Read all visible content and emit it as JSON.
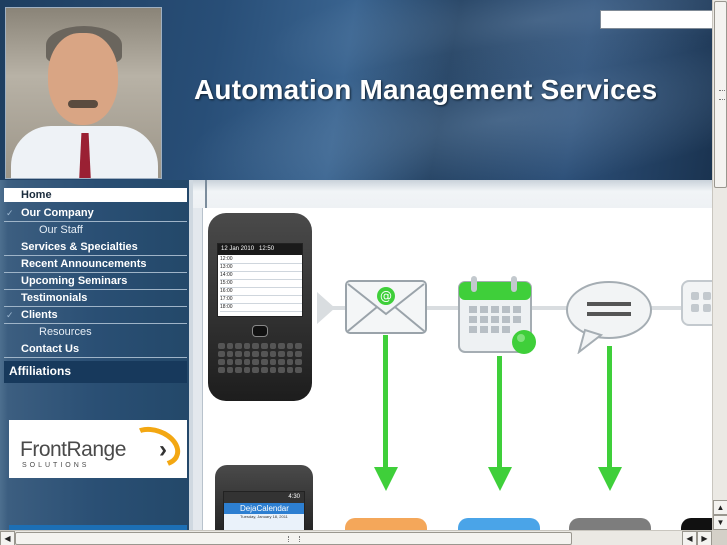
{
  "header": {
    "site_title": "Automation Management Services",
    "search_placeholder": ""
  },
  "sidebar": {
    "nav_items": [
      {
        "label": "Home",
        "active": true
      },
      {
        "label": "Our Company",
        "expanded": true
      },
      {
        "label": "Our Staff",
        "sub": true
      },
      {
        "label": "Services & Specialties"
      },
      {
        "label": "Recent Announcements"
      },
      {
        "label": "Upcoming Seminars"
      },
      {
        "label": "Testimonials"
      },
      {
        "label": "Clients",
        "expanded": true
      },
      {
        "label": "Resources",
        "sub": true
      },
      {
        "label": "Contact Us"
      }
    ],
    "affiliations_label": "Affiliations",
    "logo": {
      "name": "FrontRange",
      "tagline": "SOLUTIONS"
    }
  },
  "content": {
    "phone1": {
      "status": "12 Jan 2010",
      "clock": "12:50",
      "times": [
        "12:00",
        "13:00",
        "14:00",
        "15:00",
        "16:00",
        "17:00",
        "18:00"
      ]
    },
    "phone2": {
      "clock": "4:30",
      "app_title": "DejaCalendar",
      "date_line": "Tuesday, January 18, 2011"
    },
    "icons": [
      "email-icon",
      "calendar-icon",
      "chat-bubble-icon",
      "keypad-icon"
    ]
  },
  "colors": {
    "header_blue": "#1e3e60",
    "sidebar_blue": "#2a4f74",
    "arrow_green": "#3fcf3a",
    "logo_orange": "#f3a712"
  }
}
